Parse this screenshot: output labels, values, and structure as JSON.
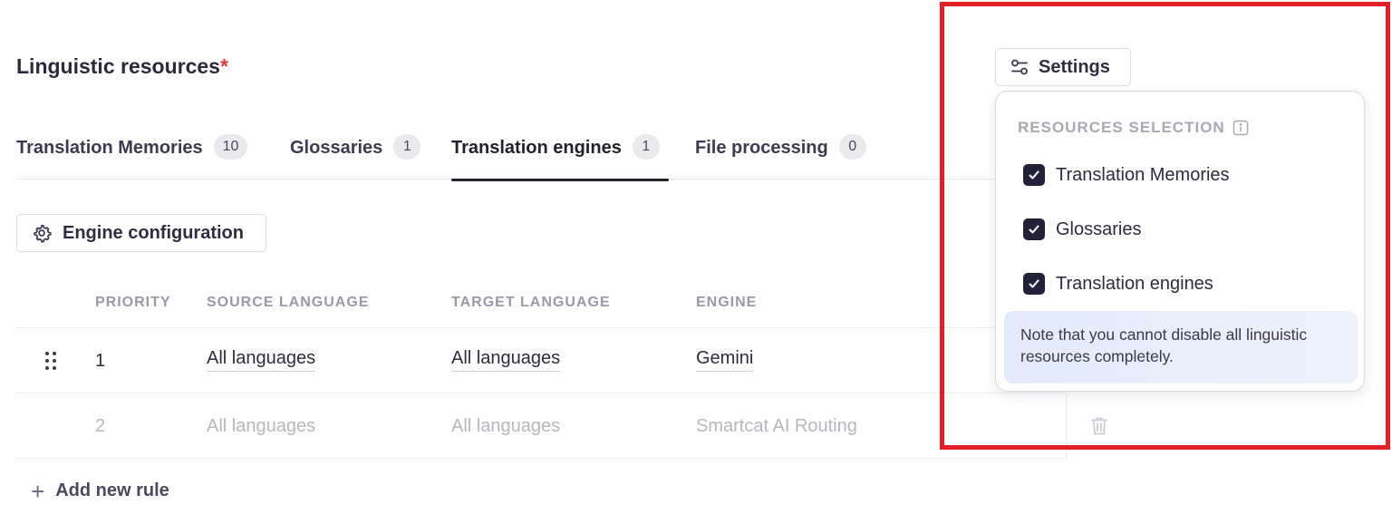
{
  "header": {
    "title": "Linguistic resources",
    "required_mark": "*",
    "settings_label": "Settings"
  },
  "tabs": [
    {
      "label": "Translation Memories",
      "count": "10",
      "active": false
    },
    {
      "label": "Glossaries",
      "count": "1",
      "active": false
    },
    {
      "label": "Translation engines",
      "count": "1",
      "active": true
    },
    {
      "label": "File processing",
      "count": "0",
      "active": false
    }
  ],
  "engine_config": {
    "label": "Engine configuration"
  },
  "table": {
    "headers": [
      "PRIORITY",
      "SOURCE LANGUAGE",
      "TARGET LANGUAGE",
      "ENGINE"
    ],
    "rows": [
      {
        "priority": "1",
        "source": "All languages",
        "target": "All languages",
        "engine": "Gemini",
        "enabled": true
      },
      {
        "priority": "2",
        "source": "All languages",
        "target": "All languages",
        "engine": "Smartcat AI Routing",
        "enabled": false
      }
    ]
  },
  "add_rule": {
    "label": "Add new rule"
  },
  "settings_popover": {
    "heading": "RESOURCES SELECTION",
    "options": [
      {
        "label": "Translation Memories",
        "checked": true
      },
      {
        "label": "Glossaries",
        "checked": true
      },
      {
        "label": "Translation engines",
        "checked": true
      }
    ],
    "note": "Note that you cannot disable all linguistic resources completely."
  },
  "colors": {
    "accent_dark": "#22213a",
    "highlight_border": "#e41e26",
    "required": "#e5383b",
    "note_bg": "#e3eaf9"
  },
  "icons": [
    "gear-icon",
    "settings-sliders-icon",
    "info-icon",
    "check-icon",
    "drag-handle-icon",
    "trash-icon",
    "plus-icon"
  ]
}
